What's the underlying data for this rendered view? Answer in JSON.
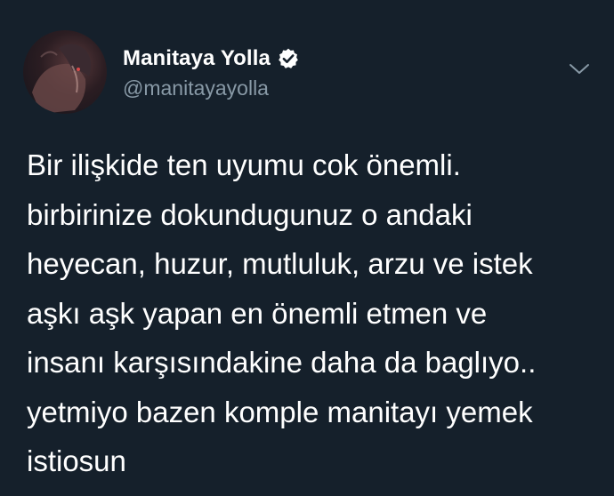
{
  "author": {
    "display_name": "Manitaya Yolla",
    "handle": "@manitayayolla",
    "verified": true,
    "avatar_icon": "profile-photo"
  },
  "menu_icon": "chevron-down-icon",
  "tweet": {
    "lines": [
      "Bir ilişkide ten uyumu cok önemli.",
      "birbirinize dokundugunuz o andaki",
      "heyecan, huzur, mutluluk, arzu ve istek",
      "aşkı aşk yapan en önemli etmen ve",
      "insanı karşısındakine daha da baglıyo..",
      "yetmiyo bazen komple manitayı yemek",
      "istiosun"
    ]
  },
  "colors": {
    "background": "#15202b",
    "text": "#ffffff",
    "secondary_text": "#8899a6",
    "verified_badge": "#ffffff"
  }
}
